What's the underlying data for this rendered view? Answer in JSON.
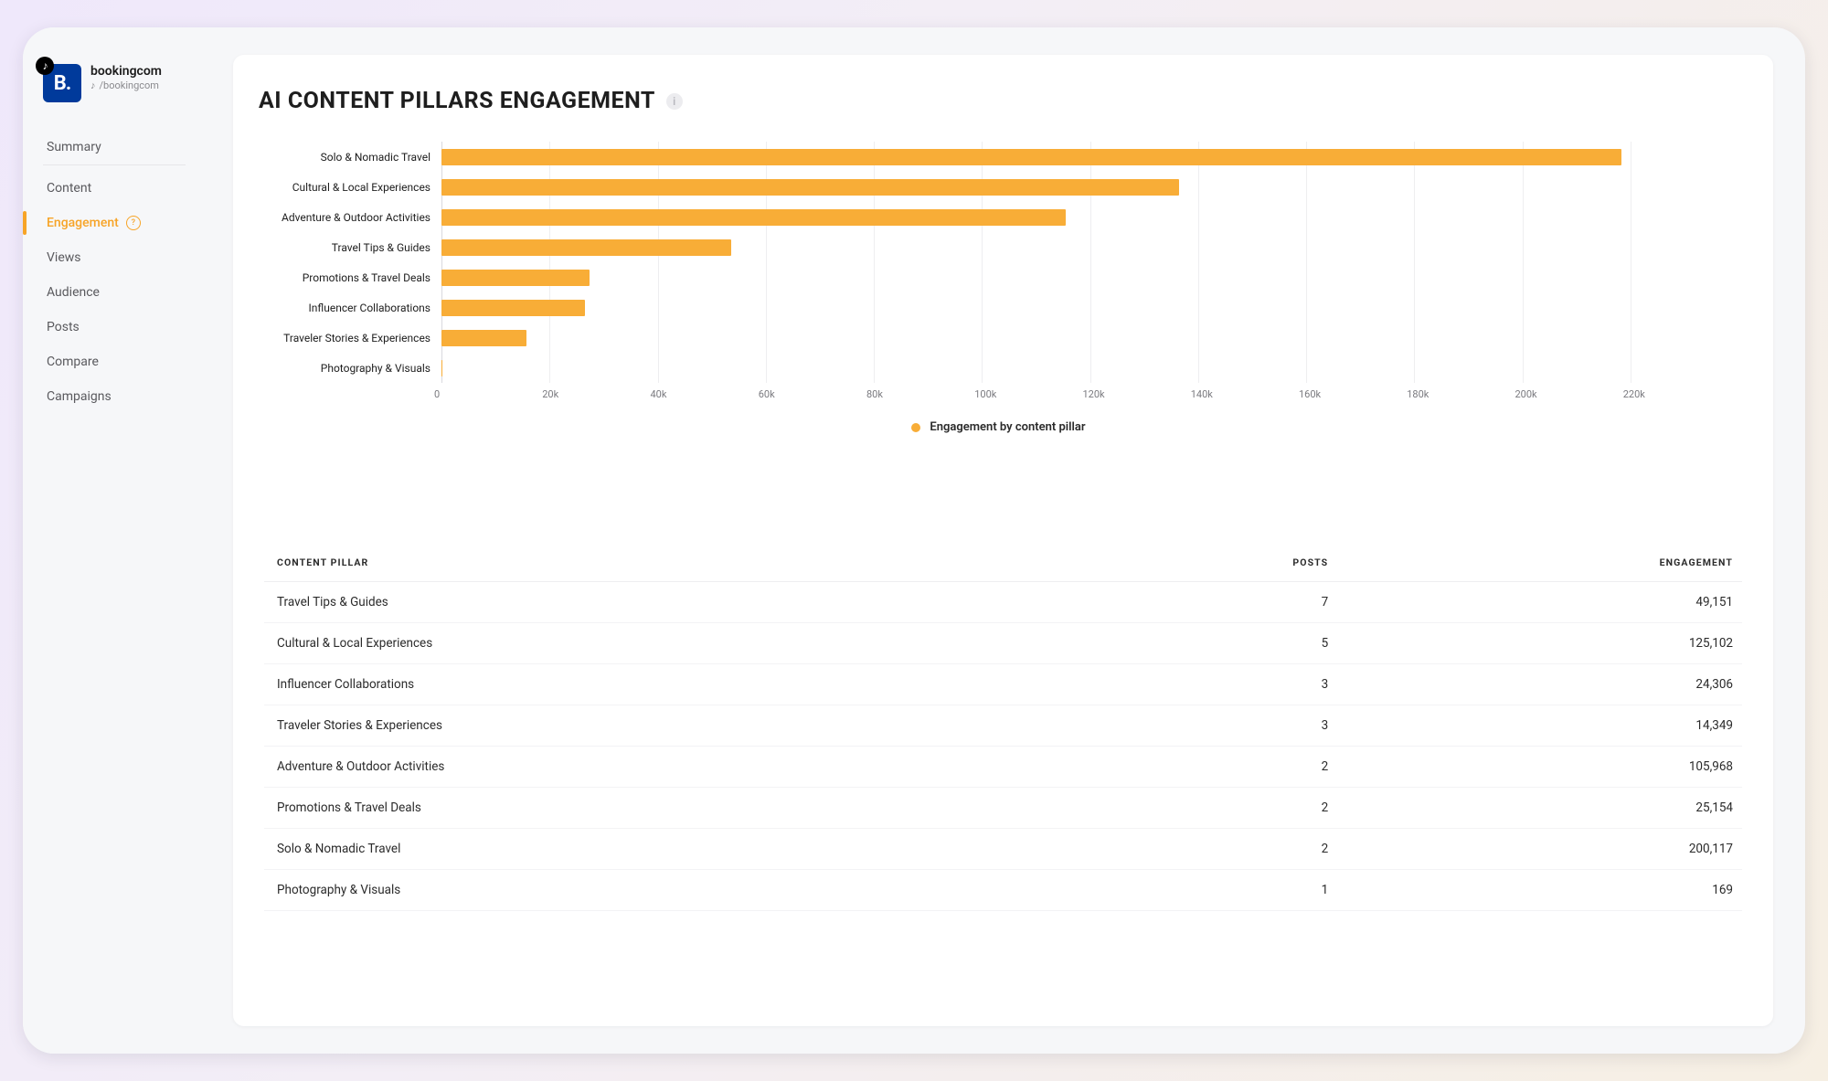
{
  "brand": {
    "logo_text": "B.",
    "name": "bookingcom",
    "handle": "/bookingcom",
    "badge_glyph": "♪"
  },
  "nav": {
    "items": [
      {
        "label": "Summary",
        "key": "summary",
        "active": false,
        "first": true
      },
      {
        "label": "Content",
        "key": "content",
        "active": false
      },
      {
        "label": "Engagement",
        "key": "engagement",
        "active": true,
        "has_info": true
      },
      {
        "label": "Views",
        "key": "views",
        "active": false
      },
      {
        "label": "Audience",
        "key": "audience",
        "active": false
      },
      {
        "label": "Posts",
        "key": "posts",
        "active": false
      },
      {
        "label": "Compare",
        "key": "compare",
        "active": false
      },
      {
        "label": "Campaigns",
        "key": "campaigns",
        "active": false
      }
    ]
  },
  "page": {
    "title": "AI CONTENT PILLARS ENGAGEMENT"
  },
  "chart_data": {
    "type": "bar",
    "orientation": "horizontal",
    "title": "AI CONTENT PILLARS ENGAGEMENT",
    "xlabel": "",
    "ylabel": "",
    "xlim": [
      0,
      220000
    ],
    "x_ticks": [
      "0",
      "20k",
      "40k",
      "60k",
      "80k",
      "100k",
      "120k",
      "140k",
      "160k",
      "180k",
      "200k",
      "220k"
    ],
    "categories": [
      "Solo & Nomadic Travel",
      "Cultural & Local Experiences",
      "Adventure & Outdoor Activities",
      "Travel Tips & Guides",
      "Promotions & Travel Deals",
      "Influencer Collaborations",
      "Traveler Stories & Experiences",
      "Photography & Visuals"
    ],
    "series": [
      {
        "name": "Engagement by content pillar",
        "values": [
          200117,
          125102,
          105968,
          49151,
          25154,
          24306,
          14349,
          169
        ]
      }
    ],
    "legend_label": "Engagement by content pillar"
  },
  "table": {
    "columns": [
      "CONTENT PILLAR",
      "POSTS",
      "ENGAGEMENT"
    ],
    "rows": [
      {
        "pillar": "Travel Tips & Guides",
        "posts": "7",
        "engagement": "49,151"
      },
      {
        "pillar": "Cultural & Local Experiences",
        "posts": "5",
        "engagement": "125,102"
      },
      {
        "pillar": "Influencer Collaborations",
        "posts": "3",
        "engagement": "24,306"
      },
      {
        "pillar": "Traveler Stories & Experiences",
        "posts": "3",
        "engagement": "14,349"
      },
      {
        "pillar": "Adventure & Outdoor Activities",
        "posts": "2",
        "engagement": "105,968"
      },
      {
        "pillar": "Promotions & Travel Deals",
        "posts": "2",
        "engagement": "25,154"
      },
      {
        "pillar": "Solo & Nomadic Travel",
        "posts": "2",
        "engagement": "200,117"
      },
      {
        "pillar": "Photography & Visuals",
        "posts": "1",
        "engagement": "169"
      }
    ]
  }
}
